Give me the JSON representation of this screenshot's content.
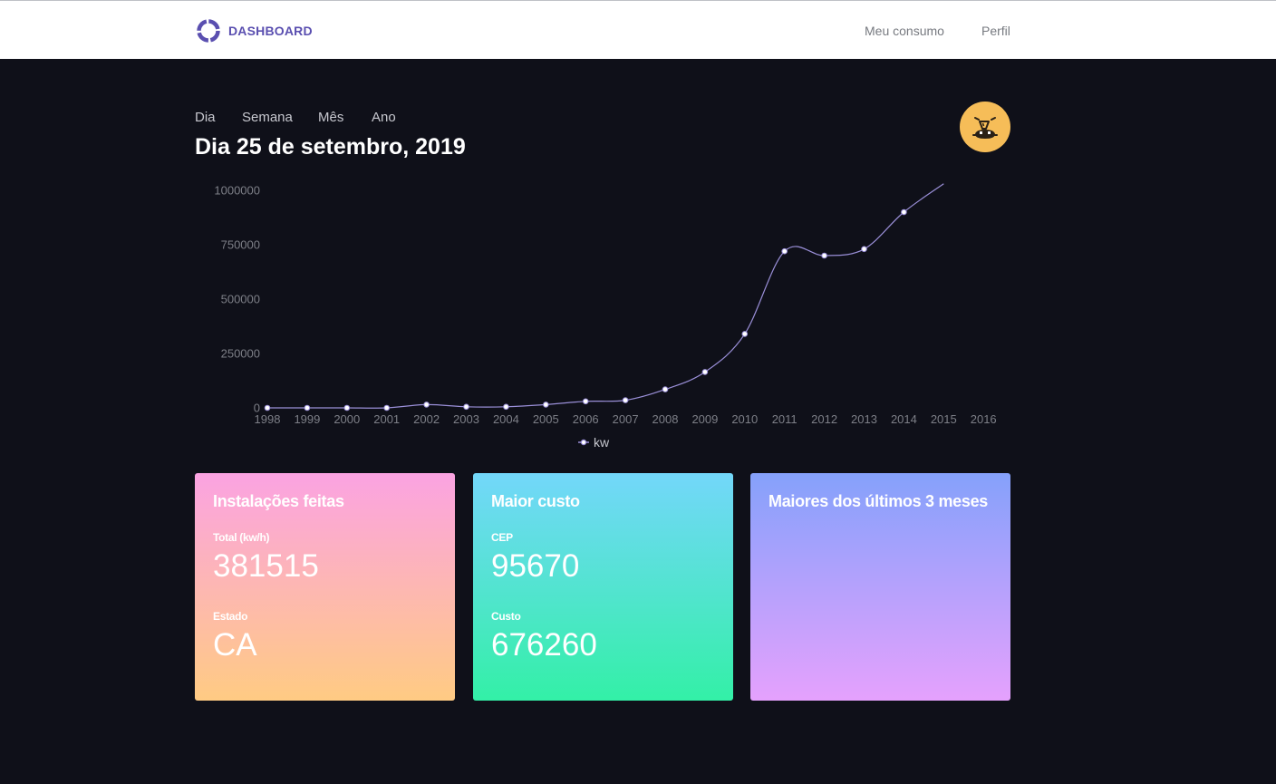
{
  "header": {
    "brand": "DASHBOARD",
    "logo_icon": "ring-logo-icon",
    "nav": {
      "consumo": "Meu consumo",
      "perfil": "Perfil"
    },
    "brand_color": "#5a4fb0"
  },
  "period_tabs": [
    "Dia",
    "Semana",
    "Mês",
    "Ano"
  ],
  "title": "Dia 25 de setembro, 2019",
  "avatar_icon": "monster-face-icon",
  "chart_data": {
    "type": "line",
    "x": [
      "1998",
      "1999",
      "2000",
      "2001",
      "2002",
      "2003",
      "2004",
      "2005",
      "2006",
      "2007",
      "2008",
      "2009",
      "2010",
      "2011",
      "2012",
      "2013",
      "2014",
      "2015",
      "2016"
    ],
    "series": [
      {
        "name": "kw",
        "values": [
          0,
          0,
          0,
          0,
          15000,
          5000,
          5000,
          15000,
          30000,
          35000,
          85000,
          165000,
          340000,
          720000,
          700000,
          730000,
          900000,
          1030000,
          null
        ]
      }
    ],
    "yticks": [
      "0",
      "250000",
      "500000",
      "750000",
      "1000000"
    ],
    "ylim": [
      0,
      1000000
    ],
    "line_color": "#9a8fd8",
    "legend": "bottom",
    "grid": false
  },
  "cards": [
    {
      "title": "Instalações feitas",
      "label1": "Total (kw/h)",
      "value1": "381515",
      "label2": "Estado",
      "value2": "CA"
    },
    {
      "title": "Maior custo",
      "label1": "CEP",
      "value1": "95670",
      "label2": "Custo",
      "value2": "676260"
    },
    {
      "title": "Maiores dos últimos 3 meses"
    }
  ]
}
